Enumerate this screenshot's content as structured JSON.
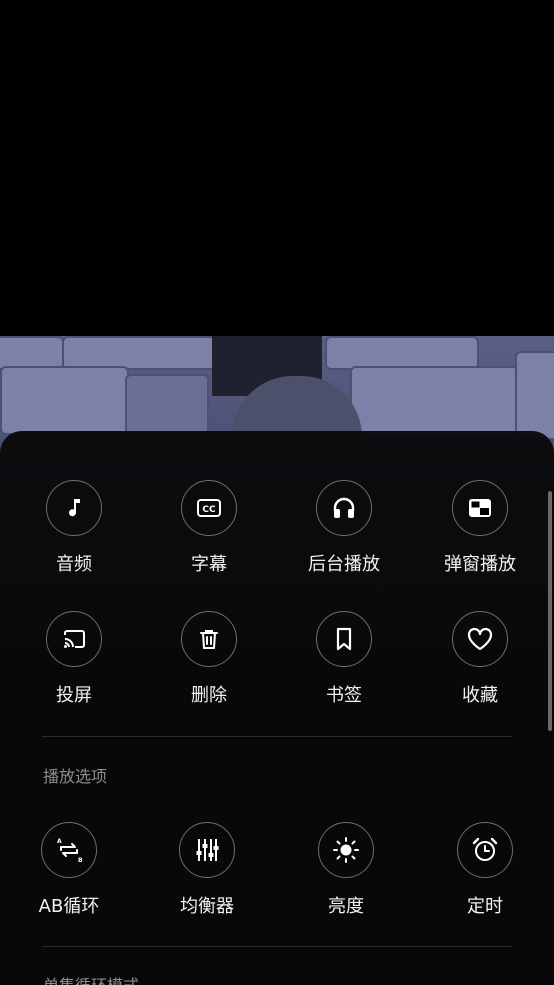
{
  "video": {
    "background": "#4a4e72"
  },
  "quick_actions": [
    {
      "label": "音频",
      "icon": "music-note-icon"
    },
    {
      "label": "字幕",
      "icon": "closed-caption-icon"
    },
    {
      "label": "后台播放",
      "icon": "headphones-icon"
    },
    {
      "label": "弹窗播放",
      "icon": "picture-in-picture-icon"
    },
    {
      "label": "投屏",
      "icon": "cast-icon"
    },
    {
      "label": "删除",
      "icon": "trash-icon"
    },
    {
      "label": "书签",
      "icon": "bookmark-icon"
    },
    {
      "label": "收藏",
      "icon": "heart-icon"
    }
  ],
  "playback_options": {
    "title": "播放选项",
    "items": [
      {
        "label": "AB循环",
        "icon": "ab-repeat-icon"
      },
      {
        "label": "均衡器",
        "icon": "equalizer-icon"
      },
      {
        "label": "亮度",
        "icon": "brightness-icon"
      },
      {
        "label": "定时",
        "icon": "alarm-clock-icon"
      }
    ]
  },
  "next_section": {
    "title": "单集循环模式"
  },
  "colors": {
    "sheet": "#08080a",
    "divider": "#2a2a2c",
    "section_title": "#8d8d90",
    "icon_ring": "#6d6d70"
  }
}
